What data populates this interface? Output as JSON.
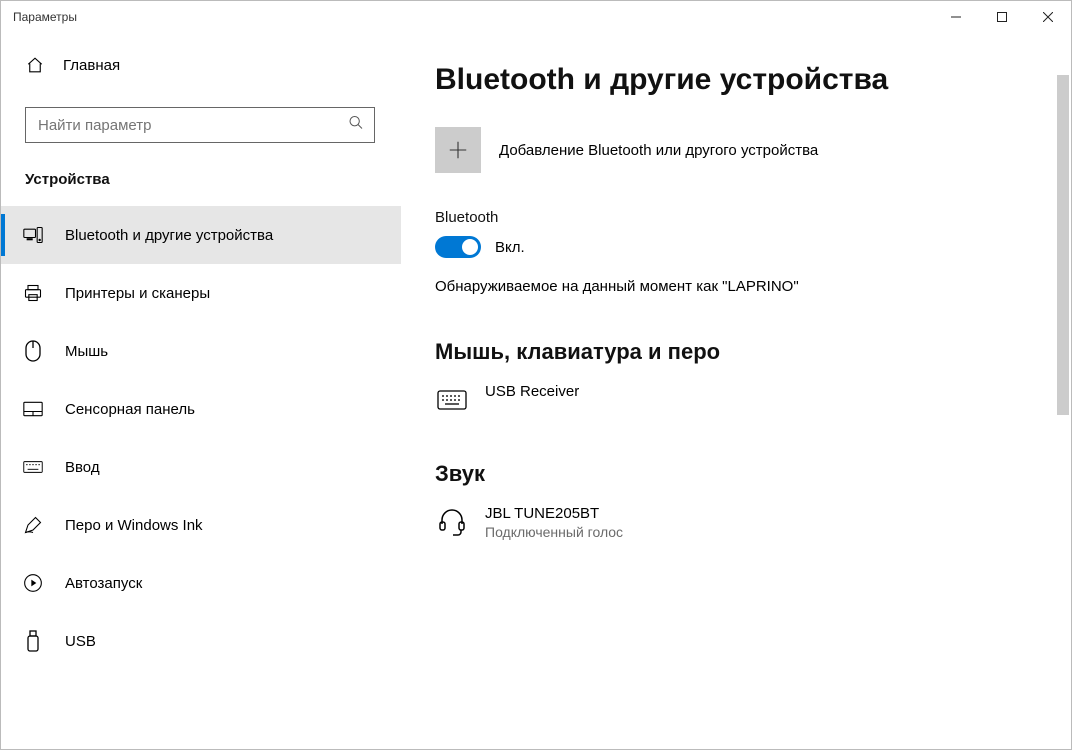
{
  "window": {
    "title": "Параметры"
  },
  "sidebar": {
    "home": "Главная",
    "search_placeholder": "Найти параметр",
    "category": "Устройства",
    "items": [
      {
        "label": "Bluetooth и другие устройства"
      },
      {
        "label": "Принтеры и сканеры"
      },
      {
        "label": "Мышь"
      },
      {
        "label": "Сенсорная панель"
      },
      {
        "label": "Ввод"
      },
      {
        "label": "Перо и Windows Ink"
      },
      {
        "label": "Автозапуск"
      },
      {
        "label": "USB"
      }
    ]
  },
  "main": {
    "title": "Bluetooth и другие устройства",
    "add_label": "Добавление Bluetooth или другого устройства",
    "bluetooth_label": "Bluetooth",
    "toggle_state": "Вкл.",
    "discoverable": "Обнаруживаемое на данный момент как \"LAPRINO\"",
    "section_mouse": "Мышь, клавиатура и перо",
    "device_mouse": {
      "name": "USB Receiver"
    },
    "section_sound": "Звук",
    "device_sound": {
      "name": "JBL TUNE205BT",
      "status": "Подключенный голос"
    }
  }
}
